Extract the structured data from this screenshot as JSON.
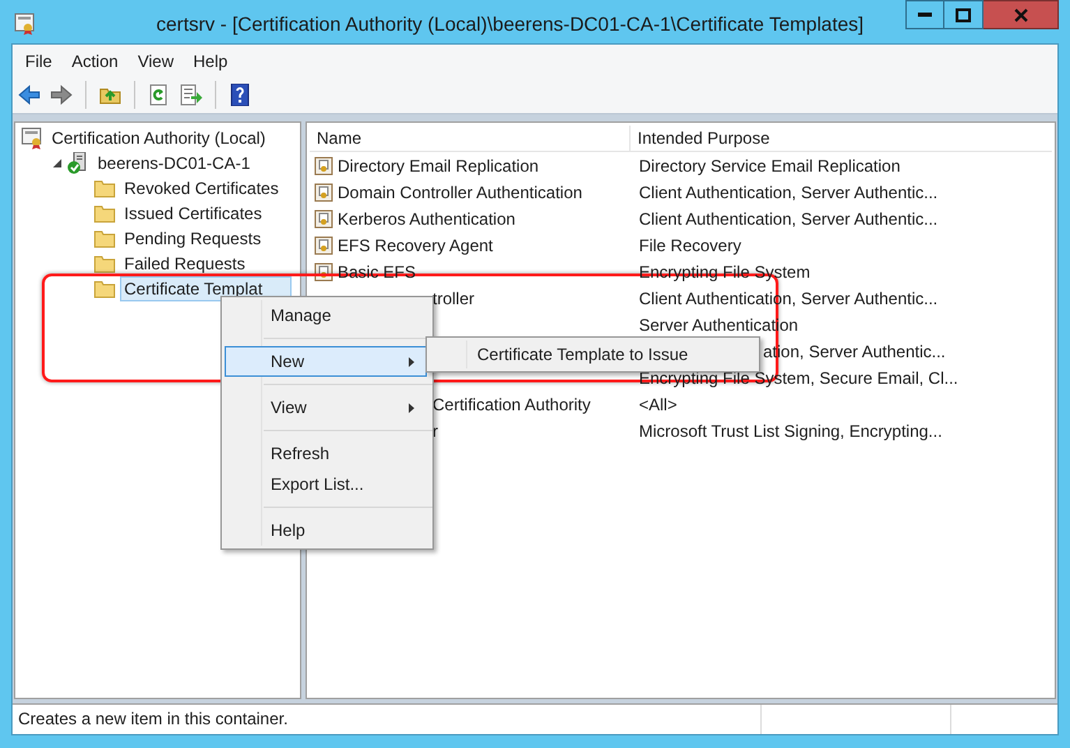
{
  "window": {
    "title": "certsrv - [Certification Authority (Local)\\beerens-DC01-CA-1\\Certificate Templates]"
  },
  "menu_bar": [
    "File",
    "Action",
    "View",
    "Help"
  ],
  "toolbar": [
    {
      "kind": "back"
    },
    {
      "kind": "forward"
    },
    {
      "kind": "separator"
    },
    {
      "kind": "up"
    },
    {
      "kind": "separator"
    },
    {
      "kind": "refresh"
    },
    {
      "kind": "export"
    },
    {
      "kind": "separator"
    },
    {
      "kind": "help"
    }
  ],
  "tree": [
    {
      "label": "Certification Authority (Local)",
      "kind": "authority",
      "selected": false,
      "children": [
        {
          "label": "beerens-DC01-CA-1",
          "kind": "server",
          "expanded": true,
          "selected": false,
          "children": [
            {
              "label": "Revoked Certificates",
              "kind": "folder",
              "selected": false
            },
            {
              "label": "Issued Certificates",
              "kind": "folder",
              "selected": false
            },
            {
              "label": "Pending Requests",
              "kind": "folder",
              "selected": false
            },
            {
              "label": "Failed Requests",
              "kind": "folder",
              "selected": false
            },
            {
              "label": "Certificate Templat",
              "kind": "folder",
              "selected": true
            }
          ]
        }
      ]
    }
  ],
  "table": {
    "columns": [
      "Name",
      "Intended Purpose"
    ],
    "rows": [
      {
        "kind": "full",
        "name": "Directory Email Replication",
        "purpose": "Directory Service Email Replication"
      },
      {
        "kind": "full",
        "name": "Domain Controller Authentication",
        "purpose": "Client Authentication, Server Authentic..."
      },
      {
        "kind": "full",
        "name": "Kerberos Authentication",
        "purpose": "Client Authentication, Server Authentic..."
      },
      {
        "kind": "full",
        "name": "EFS Recovery Agent",
        "purpose": "File Recovery"
      },
      {
        "kind": "full",
        "name": "Basic EFS",
        "purpose": "Encrypting File System"
      },
      {
        "kind": "behind_menu",
        "name": "troller",
        "purpose": "Client Authentication, Server Authentic..."
      },
      {
        "kind": "behind_menu",
        "purpose": "Server Authentication"
      },
      {
        "kind": "behind_submenu",
        "purpose": "ation, Server Authentic..."
      },
      {
        "kind": "behind_menu",
        "purpose": "Encrypting File System, Secure Email, Cl..."
      },
      {
        "kind": "behind_menu",
        "name": "Certification Authority",
        "purpose": "<All>"
      },
      {
        "kind": "behind_menu",
        "name": "r",
        "purpose": "Microsoft Trust List Signing, Encrypting..."
      }
    ]
  },
  "context_menu": {
    "items": [
      {
        "kind": "item",
        "label": "Manage",
        "submenu": false,
        "selected": false
      },
      {
        "kind": "separator"
      },
      {
        "kind": "item",
        "label": "New",
        "submenu": true,
        "selected": true
      },
      {
        "kind": "separator"
      },
      {
        "kind": "item",
        "label": "View",
        "submenu": true,
        "selected": false
      },
      {
        "kind": "separator"
      },
      {
        "kind": "item",
        "label": "Refresh",
        "submenu": false,
        "selected": false
      },
      {
        "kind": "item",
        "label": "Export List...",
        "submenu": false,
        "selected": false
      },
      {
        "kind": "separator"
      },
      {
        "kind": "item",
        "label": "Help",
        "submenu": false,
        "selected": false
      }
    ]
  },
  "submenu": {
    "items": [
      {
        "label": "Certificate Template to Issue",
        "selected": false
      }
    ]
  },
  "status_bar": {
    "text": "Creates a new item in this container."
  }
}
